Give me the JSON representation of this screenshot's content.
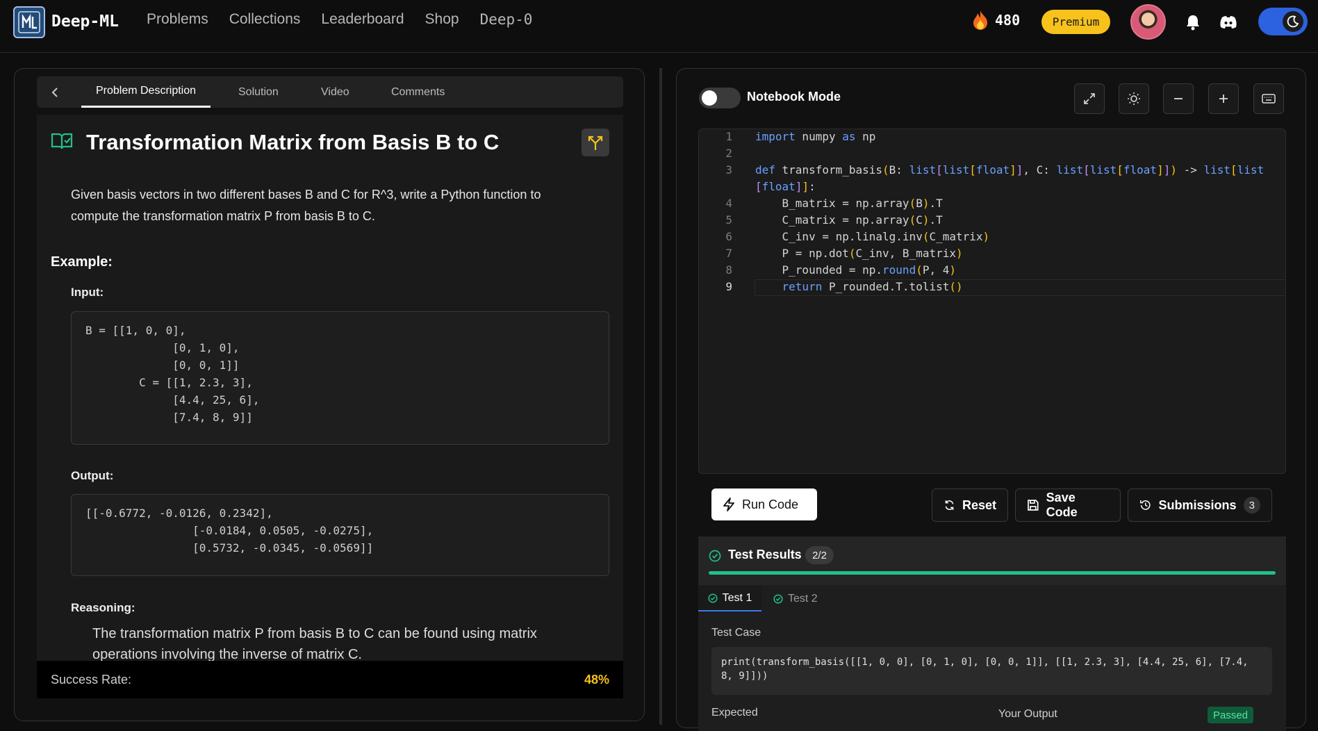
{
  "brand": {
    "name": "Deep-ML",
    "logo_text": "ML"
  },
  "nav": {
    "items": [
      "Problems",
      "Collections",
      "Leaderboard",
      "Shop",
      "Deep-0"
    ]
  },
  "streak": {
    "count": "480"
  },
  "premium_label": "Premium",
  "problem": {
    "tabs": [
      "Problem Description",
      "Solution",
      "Video",
      "Comments"
    ],
    "title": "Transformation Matrix from Basis B to C",
    "description": "Given basis vectors in two different bases B and C for R^3, write a Python function to compute the transformation matrix P from basis B to C.",
    "example_heading": "Example:",
    "input_label": "Input:",
    "input_code": "B = [[1, 0, 0],\n             [0, 1, 0],\n             [0, 0, 1]]\n        C = [[1, 2.3, 3],\n             [4.4, 25, 6],\n             [7.4, 8, 9]]",
    "output_label": "Output:",
    "output_code": "[[-0.6772, -0.0126, 0.2342],\n                [-0.0184, 0.0505, -0.0275],\n                [0.5732, -0.0345, -0.0569]]",
    "reasoning_label": "Reasoning:",
    "reasoning": "The transformation matrix P from basis B to C can be found using matrix operations involving the inverse of matrix C.",
    "success_label": "Success Rate:",
    "success_value": "48%"
  },
  "editor": {
    "notebook_label": "Notebook Mode",
    "line_numbers": [
      "1",
      "2",
      "3",
      "",
      "4",
      "5",
      "6",
      "7",
      "8",
      "9"
    ],
    "run_label": "Run Code",
    "reset_label": "Reset",
    "save_label": "Save Code",
    "submissions_label": "Submissions",
    "submissions_count": "3"
  },
  "results": {
    "title": "Test Results",
    "count": "2/2",
    "progress_fraction": 1.0,
    "tests": [
      "Test 1",
      "Test 2"
    ],
    "test_case_label": "Test Case",
    "test_case": "print(transform_basis([[1, 0, 0], [0, 1, 0], [0, 0, 1]], [[1, 2.3, 3], [4.4, 25, 6], [7.4, 8, 9]]))",
    "expected_label": "Expected",
    "your_output_label": "Your Output",
    "status": "Passed"
  },
  "colors": {
    "accent": "#f7c21b",
    "success": "#21c08b",
    "toggle": "#2c62e0"
  }
}
